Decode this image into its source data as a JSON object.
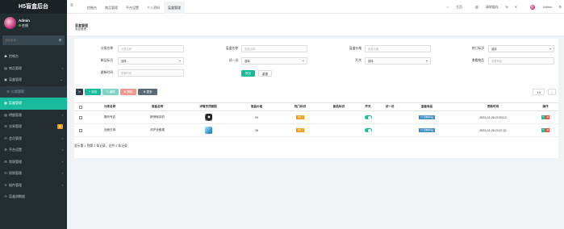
{
  "app": {
    "title": "H5盲盒后台"
  },
  "user": {
    "name": "Admin",
    "status": "在线"
  },
  "sidebar": {
    "search_placeholder": "搜索菜单",
    "items": [
      {
        "icon": "☗",
        "label": "控制台"
      },
      {
        "icon": "▤",
        "label": "商品管理",
        "arrow": "‹"
      },
      {
        "icon": "▣",
        "label": "盲盒管理",
        "arrow": "⌄"
      },
      {
        "icon": "☰",
        "label": "分类管理"
      },
      {
        "icon": "▦",
        "label": "盲盒管理"
      },
      {
        "icon": "▤",
        "label": "明细管理",
        "arrow": "‹"
      },
      {
        "icon": "☰",
        "label": "交易管理",
        "badge": "新"
      },
      {
        "icon": "☷",
        "label": "会员管理",
        "arrow": "‹"
      },
      {
        "icon": "⚙",
        "label": "平台设置",
        "arrow": "‹"
      },
      {
        "icon": "☰",
        "label": "常规管理",
        "arrow": "‹"
      },
      {
        "icon": "☷",
        "label": "权限管理",
        "arrow": "‹"
      },
      {
        "icon": "✈",
        "label": "插件管理",
        "arrow": "‹"
      },
      {
        "icon": "⊙",
        "label": "盲盒测数据"
      }
    ]
  },
  "topnav": {
    "tabs": [
      "控制台",
      "商品管理",
      "平台设置",
      "个人资料",
      "盲盒管理"
    ],
    "home": "主页",
    "clear_cache": "清除缓存",
    "user": "Admin"
  },
  "header": {
    "title": "盲盒管理",
    "subtitle": "盲盒管理"
  },
  "filters": {
    "category": {
      "label": "分类名称",
      "placeholder": "分类名称"
    },
    "box_name": {
      "label": "盲盒名称",
      "placeholder": "盲盒名称"
    },
    "price": {
      "label": "盲盒价格",
      "placeholder": "盲盒价格"
    },
    "hot": {
      "label": "热门标识",
      "value": "选择"
    },
    "new": {
      "label": "新品标识",
      "value": "选择"
    },
    "try": {
      "label": "试一试",
      "value": "选择"
    },
    "switch": {
      "label": "开关",
      "value": "选择"
    },
    "goods": {
      "label": "查看商品",
      "placeholder": "查看商品"
    },
    "updated": {
      "label": "更新时间",
      "placeholder": "更新时间"
    },
    "submit": "提交",
    "reset": "重置"
  },
  "toolbar": {
    "add": "添加",
    "edit": "编辑",
    "delete": "删除",
    "more": "更多"
  },
  "table": {
    "headers": [
      "分类名称",
      "盲盒名称",
      "详情页顶部图",
      "盲盒价格",
      "热门标识",
      "新品标识",
      "开关",
      "试一试",
      "查看商品",
      "更新时间",
      "操作"
    ],
    "rows": [
      {
        "category": "数码专区",
        "name": "新神秘耳机",
        "thumb": "headphones-image",
        "price": "99",
        "hot": "热门",
        "goods": "查看商品",
        "updated": "2022-03-28 22:53:13"
      },
      {
        "category": "全面日用",
        "name": "洗护全套裙",
        "thumb": "blue-product-image",
        "price": "38",
        "hot": "热门",
        "goods": "查看商品",
        "updated": "2022-03-28 23:07:32"
      }
    ]
  },
  "pager": {
    "info": "显示第 1 到第 2 条记录，总共 2 条记录"
  },
  "colors": {
    "accent": "#18bc9c",
    "sidebar": "#222d32",
    "warning": "#f39c12",
    "danger": "#e74c3c",
    "info": "#3c8dbc"
  }
}
